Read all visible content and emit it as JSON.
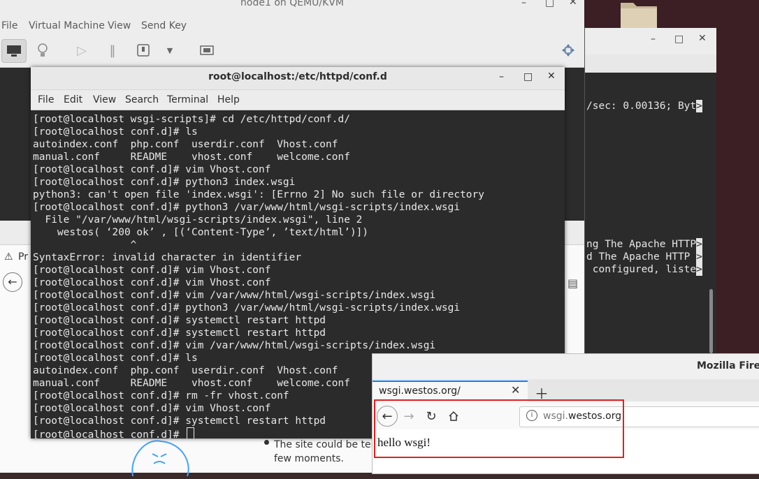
{
  "qemu": {
    "title": "node1 on QEMU/KVM",
    "menu": [
      "File",
      "Virtual Machine",
      "View",
      "Send Key"
    ]
  },
  "terminal": {
    "title": "root@localhost:/etc/httpd/conf.d",
    "menu": [
      "File",
      "Edit",
      "View",
      "Search",
      "Terminal",
      "Help"
    ],
    "lines": [
      "[root@localhost wsgi-scripts]# cd /etc/httpd/conf.d/",
      "[root@localhost conf.d]# ls",
      "autoindex.conf  php.conf  userdir.conf  Vhost.conf",
      "manual.conf     README    vhost.conf    welcome.conf",
      "[root@localhost conf.d]# vim Vhost.conf",
      "[root@localhost conf.d]# python3 index.wsgi",
      "python3: can't open file 'index.wsgi': [Errno 2] No such file or directory",
      "[root@localhost conf.d]# python3 /var/www/html/wsgi-scripts/index.wsgi",
      "  File \"/var/www/html/wsgi-scripts/index.wsgi\", line 2",
      "    westos( ‘200 ok’ , [(‘Content-Type’, ’text/html’)])",
      "                ^",
      "SyntaxError: invalid character in identifier",
      "[root@localhost conf.d]# vim Vhost.conf",
      "[root@localhost conf.d]# vim Vhost.conf",
      "[root@localhost conf.d]# vim /var/www/html/wsgi-scripts/index.wsgi",
      "[root@localhost conf.d]# python3 /var/www/html/wsgi-scripts/index.wsgi",
      "[root@localhost conf.d]# systemctl restart httpd",
      "[root@localhost conf.d]# systemctl restart httpd",
      "[root@localhost conf.d]# vim /var/www/html/wsgi-scripts/index.wsgi",
      "[root@localhost conf.d]# ls",
      "autoindex.conf  php.conf  userdir.conf  Vhost.conf",
      "manual.conf     README    vhost.conf    welcome.conf",
      "[root@localhost conf.d]# rm -fr vhost.conf",
      "[root@localhost conf.d]# vim Vhost.conf",
      "[root@localhost conf.d]# systemctl restart httpd",
      "[root@localhost conf.d]# "
    ]
  },
  "bg_terminal": {
    "lines": [
      "/sec: 0.00136; Byt>",
      "ng The Apache HTTP>",
      "d The Apache HTTP >",
      " configured, liste>"
    ]
  },
  "guest_page": {
    "bullet_line1": "The site could be tem",
    "bullet_line2": "few moments.",
    "tab_fragment": "Pr"
  },
  "firefox": {
    "window_title": "Mozilla Firefo",
    "tab_label": "wsgi.westos.org/",
    "url_prefix": "wsgi.",
    "url_domain": "westos.org",
    "page_text": "hello wsgi!"
  }
}
